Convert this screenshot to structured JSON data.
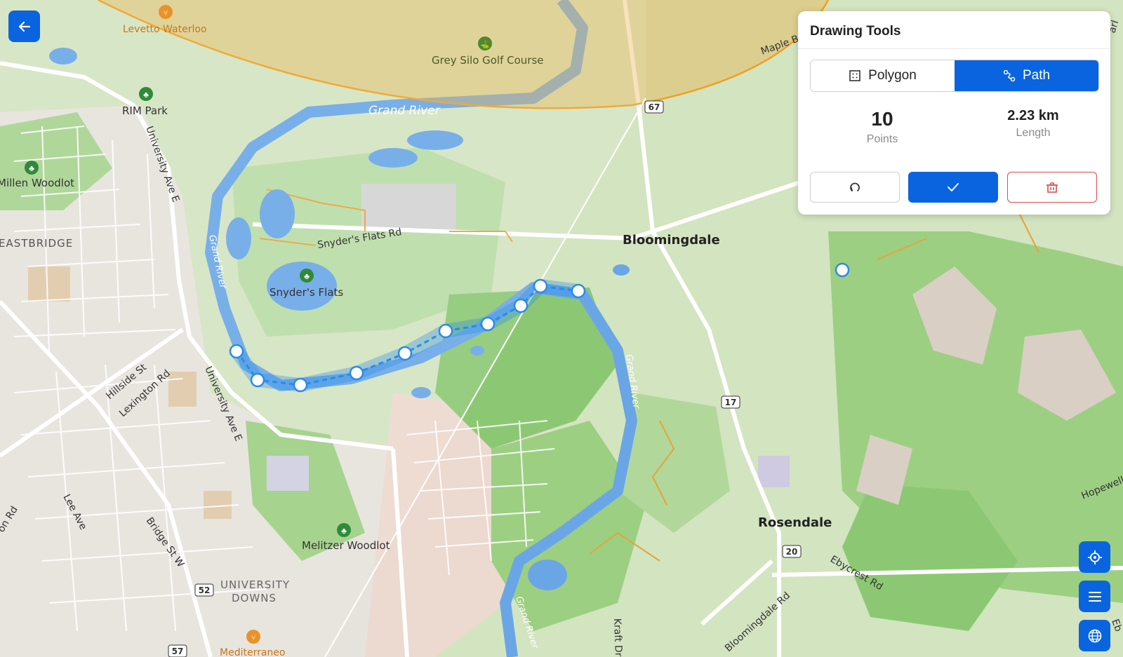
{
  "map": {
    "place_labels": {
      "levetto": "Levetto Waterloo",
      "grey_silo": "Grey Silo Golf Course",
      "rim_park": "RIM Park",
      "millen": "Millen Woodlot",
      "eastbridge": "EASTBRIDGE",
      "snyders_flats": "Snyder's Flats",
      "bloomingdale": "Bloomingdale",
      "rosendale": "Rosendale",
      "melitzer": "Melitzer Woodlot",
      "university": "UNIVERSITY",
      "downs": "DOWNS",
      "mediterraneo": "Mediterraneo"
    },
    "road_labels": {
      "university_ave_1": "University Ave E",
      "university_ave_2": "University Ave E",
      "snyders_flats_rd": "Snyder's Flats Rd",
      "hillside": "Hillside St",
      "lexington": "Lexington Rd",
      "lee_ave": "Lee Ave",
      "bridge_st": "Bridge St W",
      "on_rd": "on Rd",
      "bloomingdale_rd": "Bloomingdale Rd",
      "ebycrest": "Ebycrest Rd",
      "kraft": "Kraft Dr",
      "maple": "Maple B",
      "hopewell": "Hopewell",
      "eb": "Eb",
      "arl": "arl"
    },
    "river_labels": {
      "grand_river_top": "Grand River",
      "grand_river_left": "Grand River",
      "grand_river_mid": "Grand River",
      "grand_river_bottom": "Grand River"
    },
    "route_shields": {
      "r67": "67",
      "r17": "17",
      "r20": "20",
      "r52": "52",
      "r57": "57"
    }
  },
  "drawing_tools": {
    "title": "Drawing Tools",
    "mode_polygon": "Polygon",
    "mode_path": "Path",
    "active_mode": "path",
    "points_value": "10",
    "points_label": "Points",
    "length_value": "2.23 km",
    "length_label": "Length"
  },
  "icons": {
    "back": "arrow-left-icon",
    "polygon": "polygon-icon",
    "path": "path-icon",
    "undo": "undo-icon",
    "done": "check-icon",
    "delete": "trash-icon",
    "locate": "crosshair-icon",
    "layers": "menu-icon",
    "globe": "globe-icon"
  },
  "colors": {
    "accent": "#0a64e0",
    "danger": "#e04a4a",
    "route": "#2b8be8",
    "river": "#6aa6e6"
  }
}
